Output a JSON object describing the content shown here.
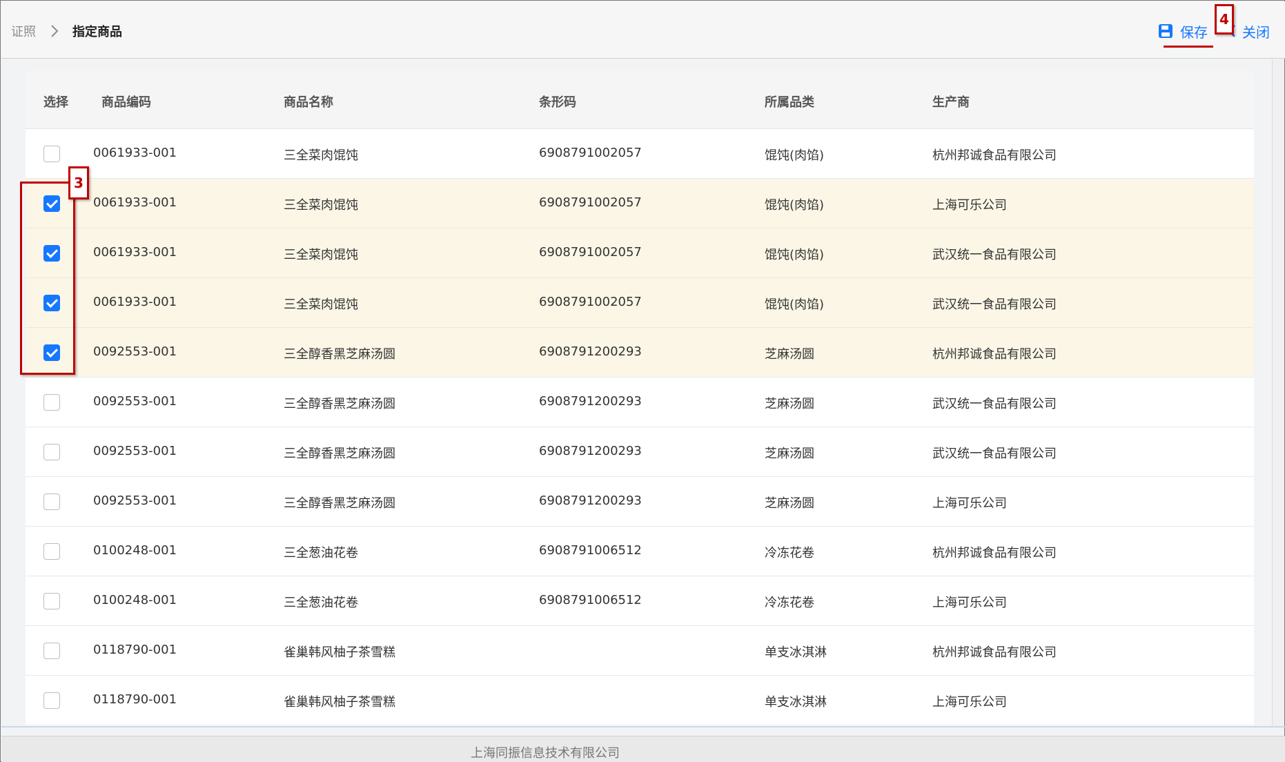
{
  "breadcrumb": {
    "root": "证照",
    "current": "指定商品"
  },
  "toolbar": {
    "save_label": "保存",
    "close_label": "关闭"
  },
  "callouts": {
    "save": "4",
    "checkbox_group": "3"
  },
  "table": {
    "headers": [
      "选择",
      "商品编码",
      "商品名称",
      "条形码",
      "所属品类",
      "生产商"
    ],
    "rows": [
      {
        "checked": false,
        "code": "0061933-001",
        "name": "三全菜肉馄饨",
        "barcode": "6908791002057",
        "category": "馄饨(肉馅)",
        "maker": "杭州邦诚食品有限公司"
      },
      {
        "checked": true,
        "code": "0061933-001",
        "name": "三全菜肉馄饨",
        "barcode": "6908791002057",
        "category": "馄饨(肉馅)",
        "maker": "上海可乐公司"
      },
      {
        "checked": true,
        "code": "0061933-001",
        "name": "三全菜肉馄饨",
        "barcode": "6908791002057",
        "category": "馄饨(肉馅)",
        "maker": "武汉统一食品有限公司"
      },
      {
        "checked": true,
        "code": "0061933-001",
        "name": "三全菜肉馄饨",
        "barcode": "6908791002057",
        "category": "馄饨(肉馅)",
        "maker": "武汉统一食品有限公司"
      },
      {
        "checked": true,
        "code": "0092553-001",
        "name": "三全醇香黑芝麻汤圆",
        "barcode": "6908791200293",
        "category": "芝麻汤圆",
        "maker": "杭州邦诚食品有限公司"
      },
      {
        "checked": false,
        "code": "0092553-001",
        "name": "三全醇香黑芝麻汤圆",
        "barcode": "6908791200293",
        "category": "芝麻汤圆",
        "maker": "武汉统一食品有限公司"
      },
      {
        "checked": false,
        "code": "0092553-001",
        "name": "三全醇香黑芝麻汤圆",
        "barcode": "6908791200293",
        "category": "芝麻汤圆",
        "maker": "武汉统一食品有限公司"
      },
      {
        "checked": false,
        "code": "0092553-001",
        "name": "三全醇香黑芝麻汤圆",
        "barcode": "6908791200293",
        "category": "芝麻汤圆",
        "maker": "上海可乐公司"
      },
      {
        "checked": false,
        "code": "0100248-001",
        "name": "三全葱油花卷",
        "barcode": "6908791006512",
        "category": "冷冻花卷",
        "maker": "杭州邦诚食品有限公司"
      },
      {
        "checked": false,
        "code": "0100248-001",
        "name": "三全葱油花卷",
        "barcode": "6908791006512",
        "category": "冷冻花卷",
        "maker": "上海可乐公司"
      },
      {
        "checked": false,
        "code": "0118790-001",
        "name": "雀巢韩风柚子茶雪糕",
        "barcode": "",
        "category": "单支冰淇淋",
        "maker": "杭州邦诚食品有限公司"
      },
      {
        "checked": false,
        "code": "0118790-001",
        "name": "雀巢韩风柚子茶雪糕",
        "barcode": "",
        "category": "单支冰淇淋",
        "maker": "上海可乐公司"
      }
    ]
  },
  "footer": {
    "company": "上海同振信息技术有限公司"
  },
  "colors": {
    "accent": "#1677ff",
    "checked_row": "#fbf6e6",
    "callout": "#c00000"
  }
}
